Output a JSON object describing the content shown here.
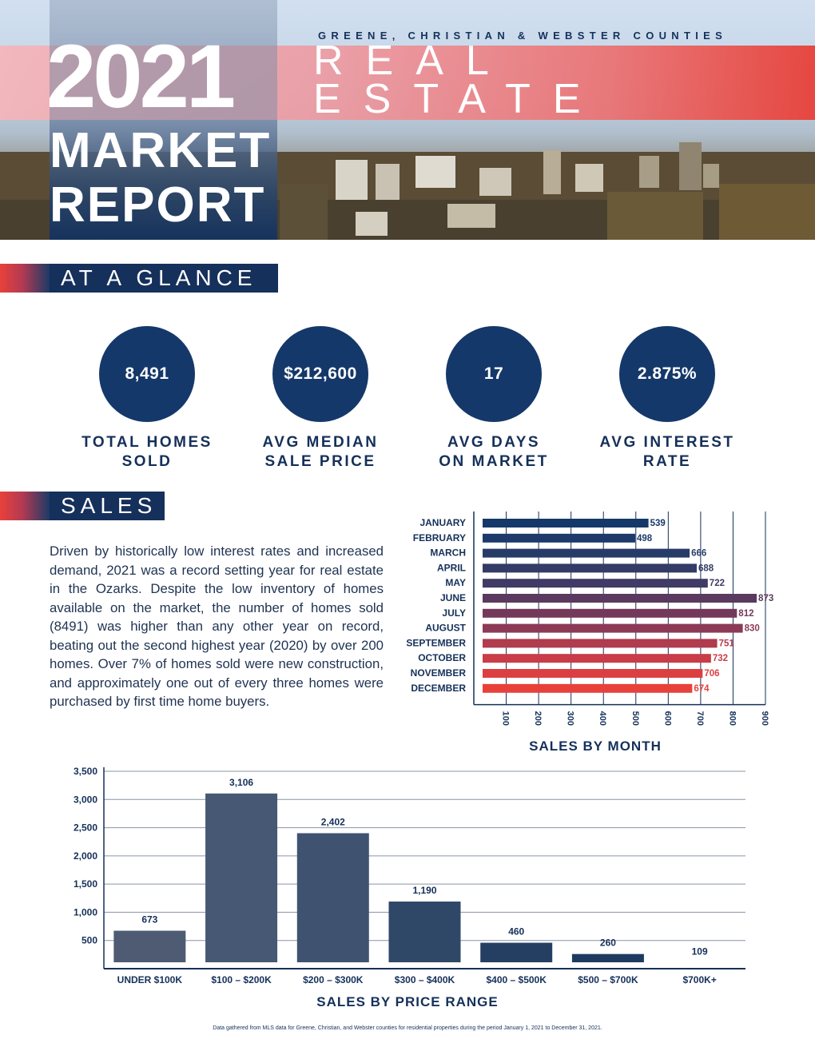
{
  "hero": {
    "counties": "GREENE, CHRISTIAN & WEBSTER COUNTIES",
    "year": "2021",
    "title_line1": "MARKET",
    "title_line2": "REPORT",
    "real": "REAL",
    "estate": "ESTATE"
  },
  "glance": {
    "header": "AT A GLANCE",
    "stats": [
      {
        "value": "8,491",
        "label": "TOTAL HOMES\nSOLD"
      },
      {
        "value": "$212,600",
        "label": "AVG MEDIAN\nSALE PRICE"
      },
      {
        "value": "17",
        "label": "AVG DAYS\nON MARKET"
      },
      {
        "value": "2.875%",
        "label": "AVG INTEREST\nRATE"
      }
    ]
  },
  "sales": {
    "header": "SALES",
    "paragraph": "Driven by historically low interest rates and increased demand, 2021 was a record setting year for real estate in the Ozarks. Despite the low inventory of homes available on the market, the number of homes sold (8491) was higher than any other year on record, beating out the second highest year (2020) by over 200 homes. Over 7% of homes sold were new construction, and approximately one out of every three homes were purchased by first time home buyers."
  },
  "chart_data": [
    {
      "type": "bar",
      "orientation": "horizontal",
      "title": "SALES BY MONTH",
      "categories": [
        "JANUARY",
        "FEBRUARY",
        "MARCH",
        "APRIL",
        "MAY",
        "JUNE",
        "JULY",
        "AUGUST",
        "SEPTEMBER",
        "OCTOBER",
        "NOVEMBER",
        "DECEMBER"
      ],
      "values": [
        539,
        498,
        666,
        688,
        722,
        873,
        812,
        830,
        751,
        732,
        706,
        674
      ],
      "xticks": [
        100,
        200,
        300,
        400,
        500,
        600,
        700,
        800,
        900
      ],
      "xlim": [
        0,
        900
      ],
      "colors": [
        "#15386a",
        "#1c3a6a",
        "#273b68",
        "#333b66",
        "#403a64",
        "#5a3a5e",
        "#74395a",
        "#8c3a56",
        "#b03c4e",
        "#c83d48",
        "#dc3f42",
        "#e8413a"
      ]
    },
    {
      "type": "bar",
      "title": "SALES BY PRICE RANGE",
      "categories": [
        "UNDER $100K",
        "$100 – $200K",
        "$200 – $300K",
        "$300 – $400K",
        "$400 – $500K",
        "$500 – $700K",
        "$700K+"
      ],
      "values": [
        673,
        3106,
        2402,
        1190,
        460,
        260,
        109
      ],
      "value_labels": [
        "673",
        "3,106",
        "2,402",
        "1,190",
        "460",
        "260",
        "109"
      ],
      "yticks": [
        500,
        1000,
        1500,
        2000,
        2500,
        3000,
        3500
      ],
      "ytick_labels": [
        "500",
        "1,000",
        "1,500",
        "2,000",
        "2,500",
        "3,000",
        "3,500"
      ],
      "ylim": [
        0,
        3500
      ],
      "grid": true,
      "colors": [
        "#4f5b73",
        "#465873",
        "#3f5270",
        "#2f4868",
        "#253f63",
        "#1e3a5f",
        "#15305a"
      ]
    }
  ],
  "footnote": "Data gathered from MLS data for Greene, Christian, and Webster counties for residential properties during the period January 1, 2021 to December 31, 2021."
}
